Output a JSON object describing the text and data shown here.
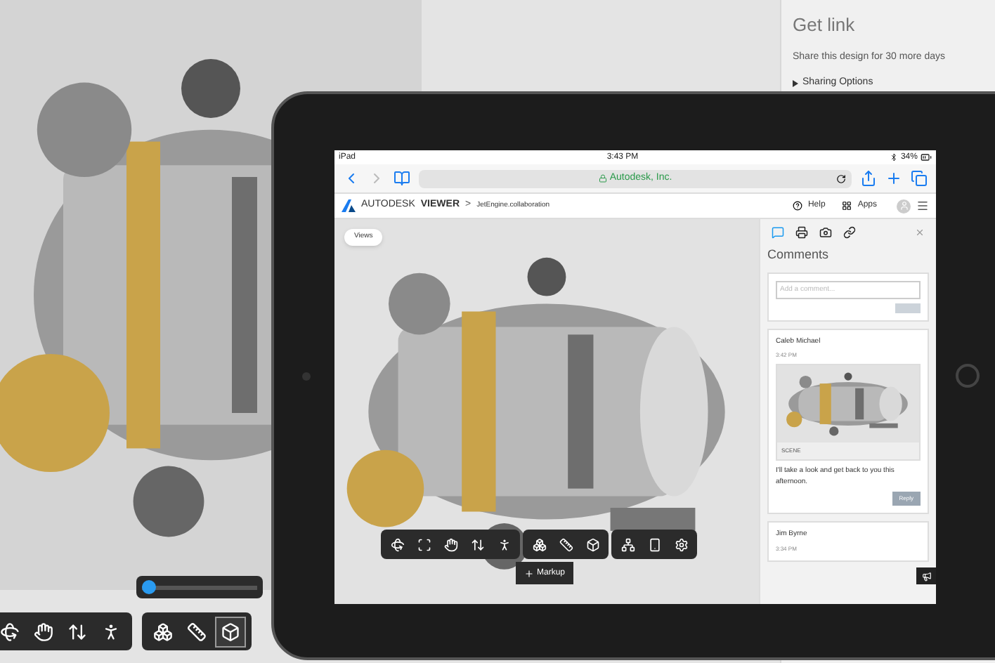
{
  "desktop": {
    "share_panel": {
      "title": "Get link",
      "text": "Share this design for 30 more days",
      "sharing_options": "Sharing Options"
    },
    "slider": {
      "level": 0.06
    },
    "tools": [
      {
        "kind": "orbit",
        "selected": false
      },
      {
        "kind": "pan",
        "selected": false
      },
      {
        "kind": "zoom",
        "selected": false
      },
      {
        "kind": "walk",
        "selected": false
      },
      {
        "kind": "explode",
        "selected": false
      },
      {
        "kind": "measure",
        "selected": false
      },
      {
        "kind": "model",
        "selected": true
      }
    ]
  },
  "tablet": {
    "status_bar": {
      "carrier": "iPad",
      "time": "3:43 PM",
      "battery": "34%"
    },
    "browser": {
      "url": "Autodesk, Inc."
    },
    "header": {
      "brand": "AUTODESK",
      "product": "VIEWER",
      "separator": ">",
      "file": "JetEngine.collaboration",
      "help": "Help",
      "apps": "Apps"
    },
    "views_button": "Views",
    "tools": [
      {
        "kind": "orbit",
        "selected": false
      },
      {
        "kind": "fit",
        "selected": false
      },
      {
        "kind": "pan",
        "selected": false
      },
      {
        "kind": "zoom",
        "selected": false
      },
      {
        "kind": "walk",
        "selected": false
      },
      {
        "kind": "explode",
        "selected": false
      },
      {
        "kind": "measure",
        "selected": false
      },
      {
        "kind": "model",
        "selected": false
      },
      {
        "kind": "structure",
        "selected": false
      },
      {
        "kind": "properties",
        "selected": false
      },
      {
        "kind": "settings",
        "selected": false
      }
    ],
    "markup_button": "Markup",
    "comments_panel": {
      "tabs": [
        {
          "kind": "comments",
          "selected": true
        },
        {
          "kind": "print",
          "selected": false
        },
        {
          "kind": "snapshot",
          "selected": false
        },
        {
          "kind": "link",
          "selected": false
        }
      ],
      "title": "Comments",
      "placeholder": "Add a comment...",
      "comments": [
        {
          "author": "Caleb Michael",
          "time": "3:42 PM",
          "snapshot_label": "SCENE",
          "text": "I'll take a look and get back to you this afternoon.",
          "reply": "Reply"
        },
        {
          "author": "Jim Byrne",
          "time": "3:34 PM"
        }
      ]
    }
  }
}
